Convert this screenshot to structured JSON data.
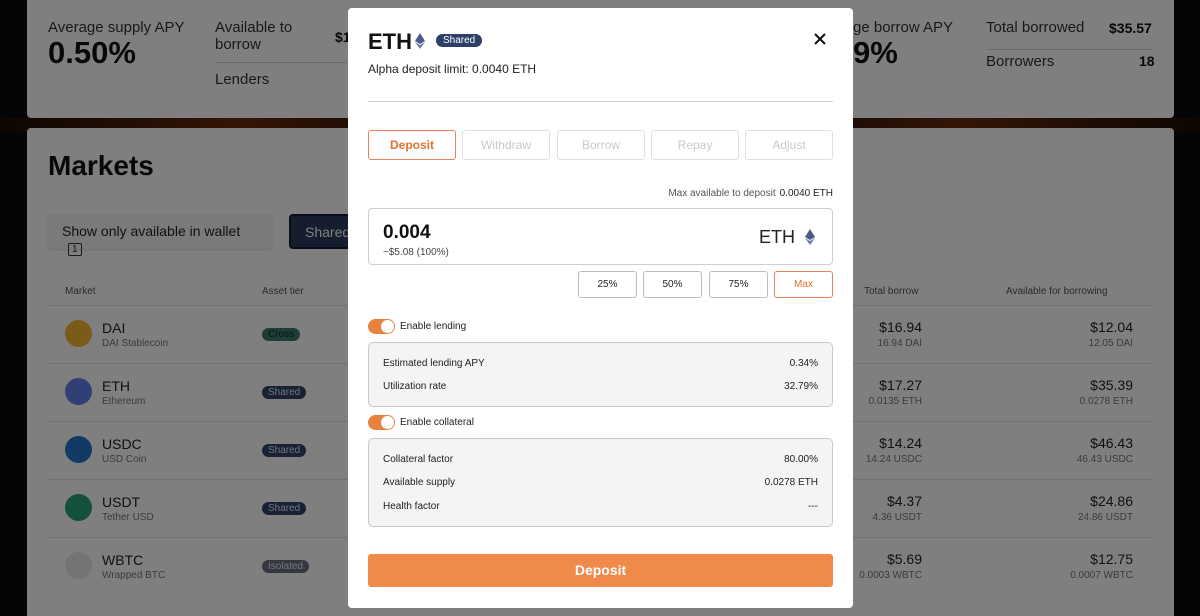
{
  "top_stats": {
    "avg_supply_label": "Average supply APY",
    "avg_supply_value": "0.50%",
    "available_label": "Available to borrow",
    "available_value": "$1",
    "lenders_label": "Lenders",
    "avg_borrow_label": "ge borrow APY",
    "avg_borrow_value": "9%",
    "total_borrowed_label": "Total borrowed",
    "total_borrowed_value": "$35.57",
    "borrowers_label": "Borrowers",
    "borrowers_value": "18"
  },
  "markets": {
    "title": "Markets",
    "wallet_filter_label": "Show only available in wallet",
    "wallet_filter_count": "1",
    "shared_filter_label": "Shared",
    "headers": {
      "market": "Market",
      "asset_tier": "Asset tier",
      "total_borrow": "Total borrow",
      "available_for_borrowing": "Available for borrowing"
    },
    "rows": [
      {
        "symbol": "DAI",
        "name": "DAI Stablecoin",
        "tier": "Cross",
        "total_borrow": "$16.94",
        "total_borrow_sub": "16.94 DAI",
        "available": "$12.04",
        "available_sub": "12.05 DAI",
        "color": "#f4b731"
      },
      {
        "symbol": "ETH",
        "name": "Ethereum",
        "tier": "Shared",
        "total_borrow": "$17.27",
        "total_borrow_sub": "0.0135 ETH",
        "available": "$35.39",
        "available_sub": "0.0278 ETH",
        "color": "#627eea"
      },
      {
        "symbol": "USDC",
        "name": "USD Coin",
        "tier": "Shared",
        "total_borrow": "$14.24",
        "total_borrow_sub": "14.24 USDC",
        "available": "$46.43",
        "available_sub": "46.43 USDC",
        "color": "#2775ca"
      },
      {
        "symbol": "USDT",
        "name": "Tether USD",
        "tier": "Shared",
        "total_borrow": "$4.37",
        "total_borrow_sub": "4.36 USDT",
        "available": "$24.86",
        "available_sub": "24.86 USDT",
        "color": "#26a17b"
      },
      {
        "symbol": "WBTC",
        "name": "Wrapped BTC",
        "tier": "Isolated",
        "total_borrow": "$5.69",
        "total_borrow_sub": "0.0003 WBTC",
        "available": "$12.75",
        "available_sub": "0.0007 WBTC",
        "color": "#e8e8e8"
      }
    ]
  },
  "modal": {
    "title": "ETH",
    "badge": "Shared",
    "close_icon": "close-icon",
    "deposit_limit": "Alpha deposit limit: 0.0040 ETH",
    "tabs": [
      "Deposit",
      "Withdraw",
      "Borrow",
      "Repay",
      "Adjust"
    ],
    "active_tab": "Deposit",
    "max_available_label": "Max available to deposit",
    "max_available_value": "0.0040 ETH",
    "amount": "0.004",
    "amount_usd": "~$5.08 (100%)",
    "amount_symbol": "ETH",
    "percent_buttons": [
      "25%",
      "50%",
      "75%",
      "Max"
    ],
    "enable_lending_label": "Enable lending",
    "lending_info": [
      {
        "label": "Estimated lending APY",
        "value": "0.34%"
      },
      {
        "label": "Utilization rate",
        "value": "32.79%"
      }
    ],
    "enable_collateral_label": "Enable collateral",
    "collateral_info": [
      {
        "label": "Collateral factor",
        "value": "80.00%"
      },
      {
        "label": "Available supply",
        "value": "0.0278 ETH"
      },
      {
        "label": "Health factor",
        "value": "---"
      }
    ],
    "submit_label": "Deposit",
    "accent_color": "#f08a4b"
  }
}
